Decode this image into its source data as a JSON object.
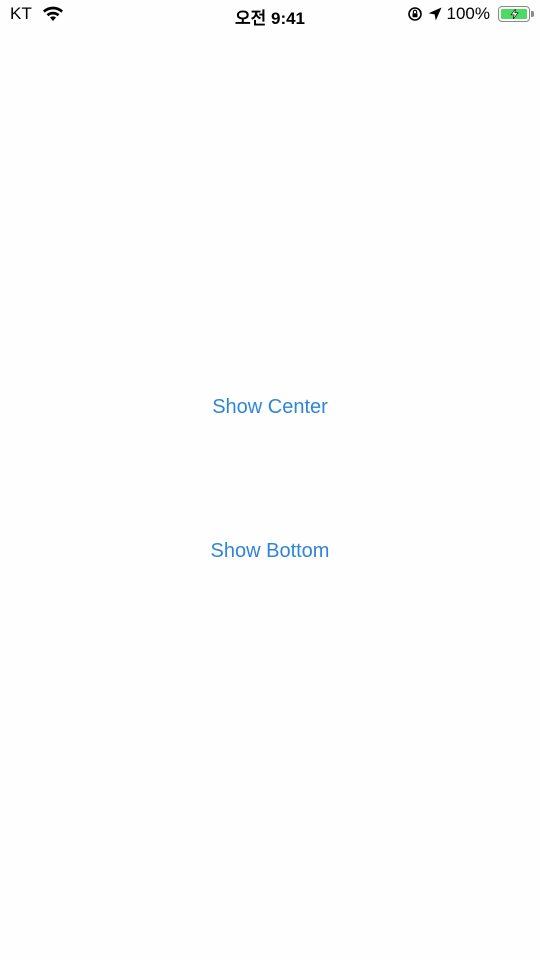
{
  "status_bar": {
    "carrier": "KT",
    "time": "오전 9:41",
    "battery_percent": "100%",
    "battery_level": 1.0,
    "icons": [
      "wifi-icon",
      "orientation-lock-icon",
      "location-arrow-icon",
      "battery-charging-icon"
    ],
    "battery_color": "#4cd964"
  },
  "main": {
    "show_center_label": "Show Center",
    "show_bottom_label": "Show Bottom",
    "accent_color": "#2f86d6"
  }
}
